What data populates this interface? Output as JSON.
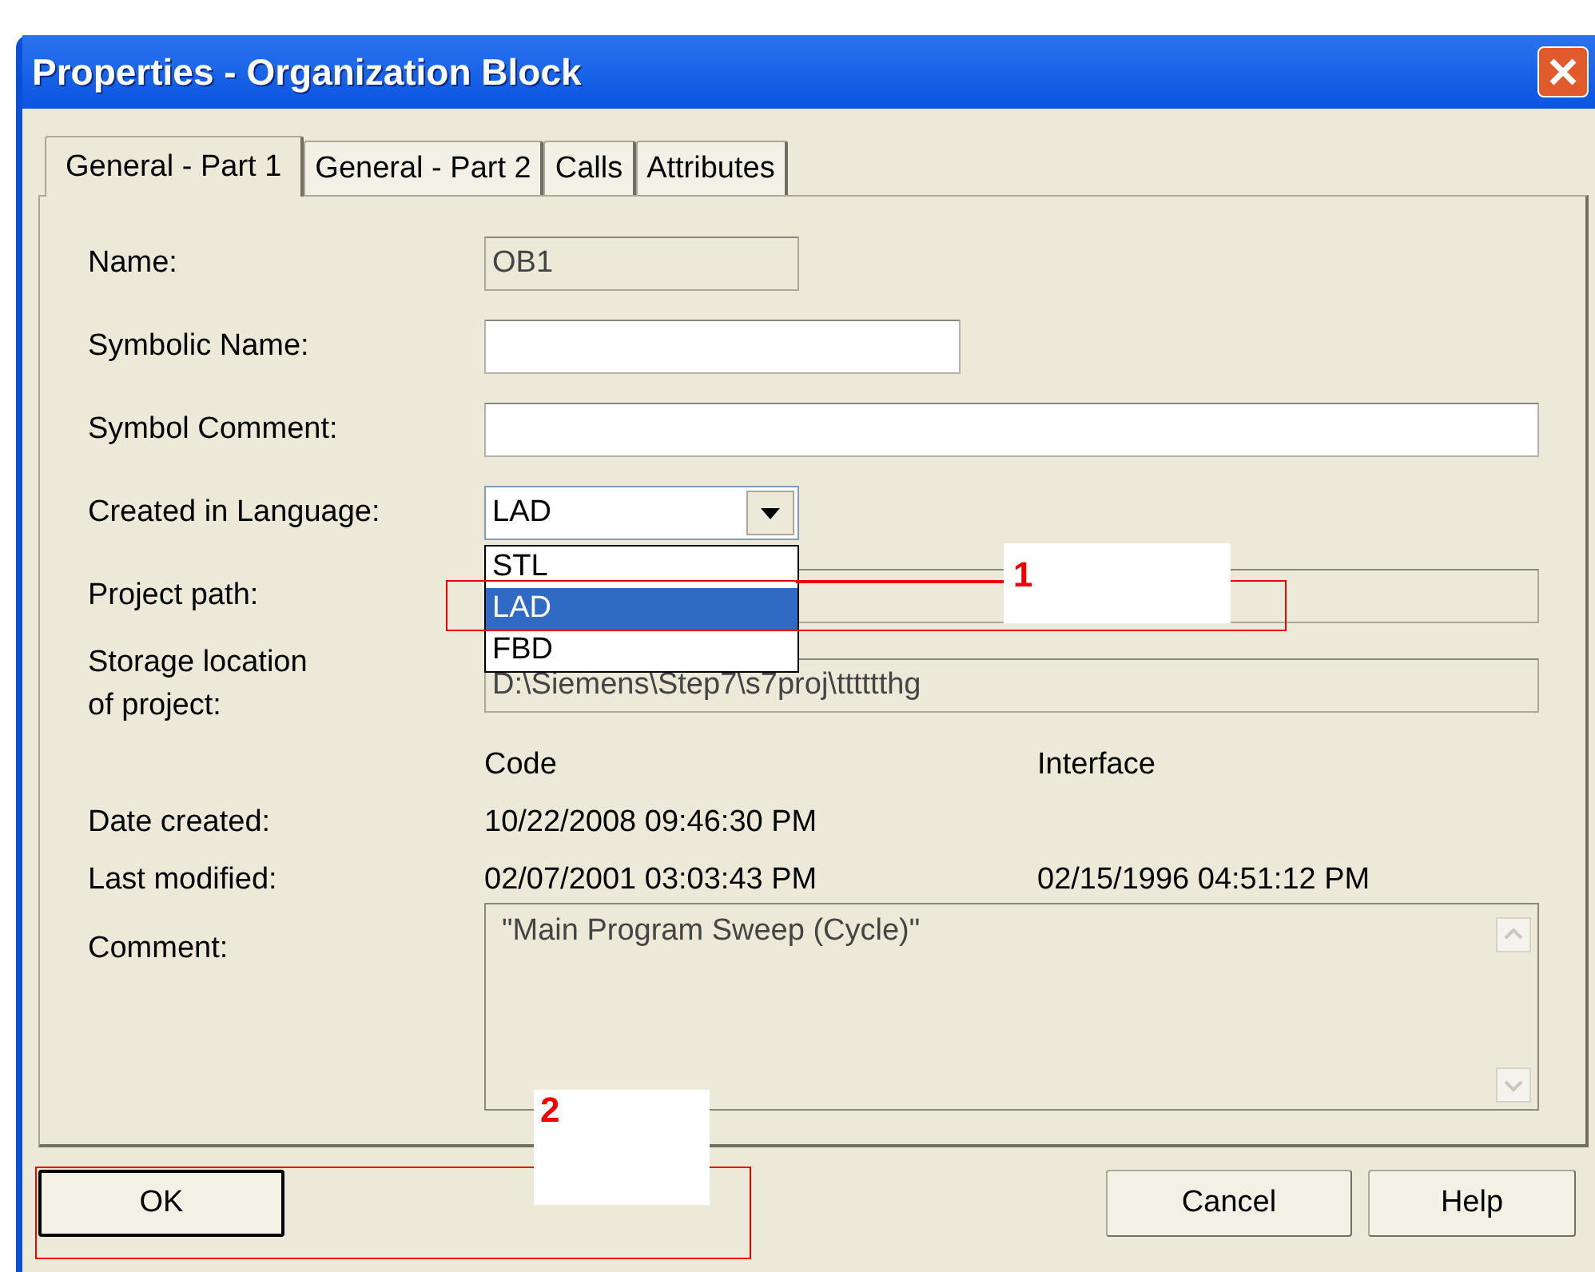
{
  "window": {
    "title": "Properties - Organization Block"
  },
  "tabs": [
    {
      "label": "General - Part 1",
      "selected": true
    },
    {
      "label": "General - Part 2",
      "selected": false
    },
    {
      "label": "Calls",
      "selected": false
    },
    {
      "label": "Attributes",
      "selected": false
    }
  ],
  "fields": [
    {
      "label": "Name:",
      "value": "OB1",
      "kind": "readonly"
    },
    {
      "label": "Symbolic Name:",
      "kind": "input"
    },
    {
      "label": "Symbol Comment:",
      "kind": "input"
    },
    {
      "label": "Created in Language:",
      "value": "LAD",
      "kind": "combo"
    },
    {
      "label": "Project path:",
      "kind": "readonly"
    },
    {
      "label": "Storage location\nof project:",
      "value": "D:\\Siemens\\Step7\\s7proj\\tttttthg",
      "kind": "readonly"
    }
  ],
  "dropdown": {
    "options": [
      {
        "label": "STL",
        "selected": false
      },
      {
        "label": "LAD",
        "selected": true
      },
      {
        "label": "FBD",
        "selected": false
      }
    ]
  },
  "dates": {
    "columns": [
      "Code",
      "Interface"
    ],
    "rows": [
      {
        "label": "Date created:",
        "code": "10/22/2008 09:46:30 PM"
      },
      {
        "label": "Last modified:",
        "code": "02/07/2001 03:03:43 PM",
        "interface": "02/15/1996 04:51:12 PM"
      }
    ]
  },
  "comment": {
    "label": "Comment:",
    "value": "\"Main Program Sweep (Cycle)\""
  },
  "buttons": [
    {
      "label": "OK",
      "default": true
    },
    {
      "label": "Cancel",
      "default": false
    },
    {
      "label": "Help",
      "default": false
    }
  ],
  "annotations": [
    "1",
    "2"
  ]
}
